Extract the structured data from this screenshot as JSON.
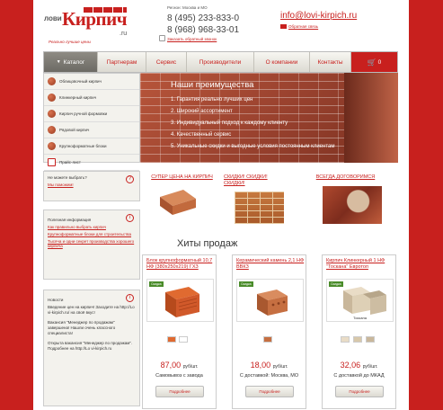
{
  "header": {
    "logo_lovi": "лови",
    "logo_kirpich": "Кирпич",
    "logo_ru": ".ru",
    "logo_slogan": "Реально лучшие цены",
    "region": "Регион: Москва и МО",
    "phone1": "8 (495) 233-833-0",
    "phone2": "8 (968) 968-33-01",
    "callback": "Заказать обратный звонок",
    "email": "info@lovi-kirpich.ru",
    "feedback": "Обратная связь"
  },
  "nav": {
    "catalog": "Каталог",
    "items": [
      "Партнерам",
      "Сервис",
      "Производители",
      "О компании",
      "Контакты"
    ],
    "cart_count": "0"
  },
  "catalog_menu": [
    "Облицовочный кирпич",
    "Клинкерный кирпич",
    "Кирпич ручной формовки",
    "Рядовой кирпич",
    "Крупноформатные блоки",
    "Прайс-лист"
  ],
  "banner": {
    "title": "Наши преимущества",
    "items": [
      "1. Гарантия реально лучших цен",
      "2. Широкий ассортимент",
      "3. Индивидуальный подход к каждому клиенту",
      "4. Качественный сервис",
      "5. Уникальные скидки и выгодные условия постоянным клиентам"
    ]
  },
  "widget_choose": {
    "title": "Не можете выбрать?",
    "link": "Мы поможем!"
  },
  "widget_info": {
    "title": "Полезная информация",
    "links": [
      "Как правильно выбрать кирпич",
      "Крупноформатные блоки для строительства",
      "Тысяча и одни секрет производства хорошего кирпича"
    ]
  },
  "widget_news": {
    "title": "Новости",
    "text1": "Введение цен на кирпич! Заходите на http://Lo vi-kirpich.ru/ на своё вкус!",
    "text2": "Вакансия \"Менеджер по продажам\" завершена! Нашли очень классного специалиста!",
    "text3": "Открыта вакансия \"Менеджер по продажам\". Подробнее на http://Lo vi-kirpich.ru"
  },
  "promos": [
    "СУПЕР ЦЕНА НА КИРПИЧ",
    "СКИДКИ! СКИДКИ! СКИДКИ!",
    "ВСЕГДА ДОГОВОРИМСЯ"
  ],
  "hits_title": "Хиты продаж",
  "products": [
    {
      "name": "Блок крупноформатный 10,7 НФ (380х250х219) ГХЗ",
      "price": "87,00",
      "unit": "руб/шт.",
      "ship": "Самовывоз с завода",
      "more": "Подробнее",
      "badge": "Скидка"
    },
    {
      "name": "Керамический камень 2,1 НФ ВВКЗ",
      "price": "18,00",
      "unit": "руб/шт.",
      "ship": "С доставкой: Москва, МО",
      "more": "Подробнее",
      "badge": "Скидка"
    },
    {
      "name": "Кирпич Клинкерный 1 НФ \"Тоскана\" Евротоп",
      "price": "32,06",
      "unit": "руб/шт.",
      "ship": "С доставкой до МКАД",
      "more": "Подробнее",
      "badge": "Скидка",
      "label": "Тоскана"
    }
  ],
  "colors": {
    "brand_red": "#c8201e",
    "brick": "#a8452c"
  }
}
